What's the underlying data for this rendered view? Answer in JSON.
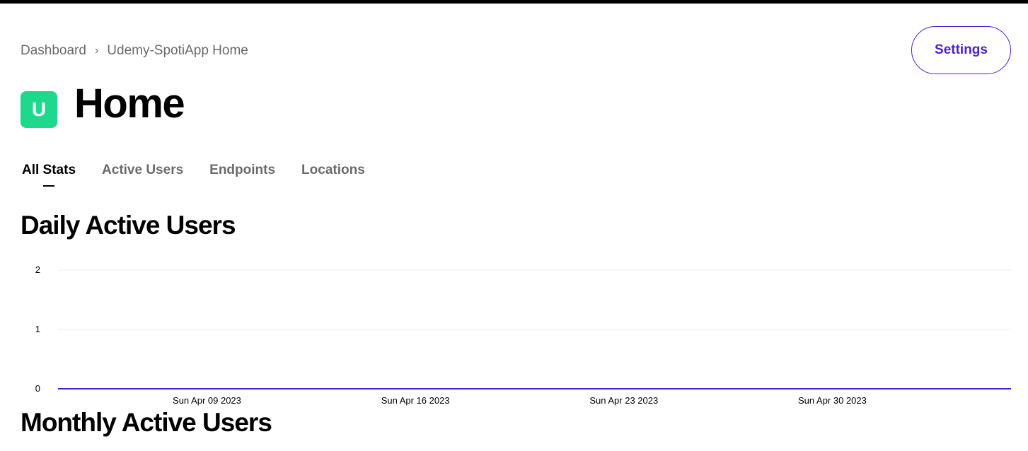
{
  "breadcrumb": {
    "items": [
      "Dashboard",
      "Udemy-SpotiApp Home"
    ],
    "separator": "›"
  },
  "header": {
    "settings_label": "Settings",
    "app_initial": "U",
    "title": "Home"
  },
  "tabs": [
    {
      "label": "All Stats",
      "active": true
    },
    {
      "label": "Active Users",
      "active": false
    },
    {
      "label": "Endpoints",
      "active": false
    },
    {
      "label": "Locations",
      "active": false
    }
  ],
  "sections": {
    "daily_title": "Daily Active Users",
    "monthly_title": "Monthly Active Users"
  },
  "colors": {
    "accent": "#4a1fd1",
    "app_badge": "#1ed98b"
  },
  "chart_data": {
    "type": "line",
    "title": "Daily Active Users",
    "xlabel": "",
    "ylabel": "",
    "ylim": [
      0,
      2
    ],
    "y_ticks": [
      "0",
      "1",
      "2"
    ],
    "x_range": [
      "2023-04-04",
      "2023-05-06"
    ],
    "x_ticks": [
      {
        "label": "Sun Apr 09 2023",
        "date": "2023-04-09"
      },
      {
        "label": "Sun Apr 16 2023",
        "date": "2023-04-16"
      },
      {
        "label": "Sun Apr 23 2023",
        "date": "2023-04-23"
      },
      {
        "label": "Sun Apr 30 2023",
        "date": "2023-04-30"
      }
    ],
    "grid": true,
    "series": [
      {
        "color": "#4a1fd1",
        "x": [
          "2023-04-04",
          "2023-05-06"
        ],
        "y": [
          0,
          0
        ]
      }
    ]
  }
}
